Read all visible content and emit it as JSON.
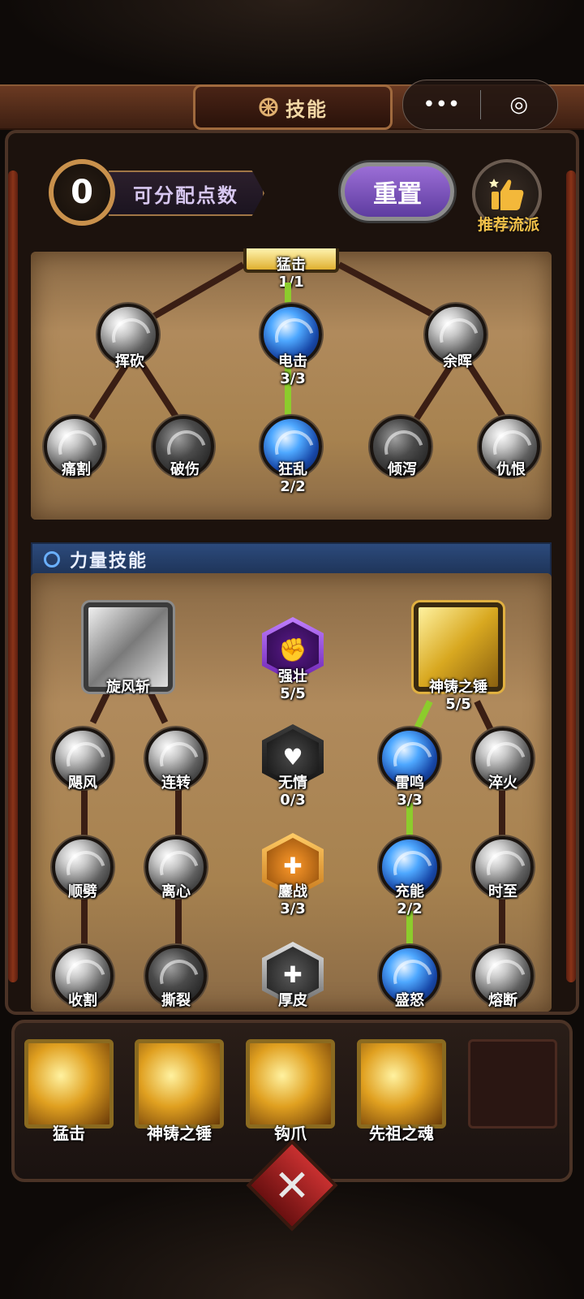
{
  "header": {
    "title": "技能",
    "capsule_more": "•••",
    "capsule_close": "◎"
  },
  "points": {
    "value": "0",
    "label": "可分配点数"
  },
  "actions": {
    "reset": "重置",
    "recommend": "推荐流派"
  },
  "upper_tree": {
    "top": {
      "name": "猛击",
      "level": "1/1"
    },
    "row1": [
      {
        "name": "挥砍",
        "level": ""
      },
      {
        "name": "电击",
        "level": "3/3"
      },
      {
        "name": "余晖",
        "level": ""
      }
    ],
    "row2": [
      {
        "name": "痛割",
        "level": ""
      },
      {
        "name": "破伤",
        "level": ""
      },
      {
        "name": "狂乱",
        "level": "2/2"
      },
      {
        "name": "倾泻",
        "level": ""
      },
      {
        "name": "仇恨",
        "level": ""
      }
    ]
  },
  "section": {
    "title": "力量技能"
  },
  "lower_tree": {
    "left_root": {
      "name": "旋风斩",
      "level": ""
    },
    "center_top": {
      "name": "强壮",
      "level": "5/5"
    },
    "right_root": {
      "name": "神铸之锤",
      "level": "5/5"
    },
    "row1": [
      {
        "name": "飓风",
        "level": ""
      },
      {
        "name": "连转",
        "level": ""
      },
      {
        "name": "无情",
        "level": "0/3"
      },
      {
        "name": "雷鸣",
        "level": "3/3"
      },
      {
        "name": "淬火",
        "level": ""
      }
    ],
    "row2": [
      {
        "name": "顺劈",
        "level": ""
      },
      {
        "name": "离心",
        "level": ""
      },
      {
        "name": "鏖战",
        "level": "3/3"
      },
      {
        "name": "充能",
        "level": "2/2"
      },
      {
        "name": "时至",
        "level": ""
      }
    ],
    "row3": [
      {
        "name": "收割",
        "level": ""
      },
      {
        "name": "撕裂",
        "level": ""
      },
      {
        "name": "厚皮",
        "level": ""
      },
      {
        "name": "盛怒",
        "level": ""
      },
      {
        "name": "熔断",
        "level": ""
      }
    ]
  },
  "equipped": [
    {
      "name": "猛击"
    },
    {
      "name": "神铸之锤"
    },
    {
      "name": "钩爪"
    },
    {
      "name": "先祖之魂"
    },
    {
      "name": ""
    }
  ],
  "colors": {
    "accent_gold": "#f3c24a",
    "active_line": "#8ccc2c",
    "reset_purple": "#7a50c0",
    "section_blue": "#2c4a7c"
  },
  "icons": {
    "close": "close-x-icon",
    "recommend": "thumbs-up-icon",
    "title": "skill-wheel-icon"
  }
}
